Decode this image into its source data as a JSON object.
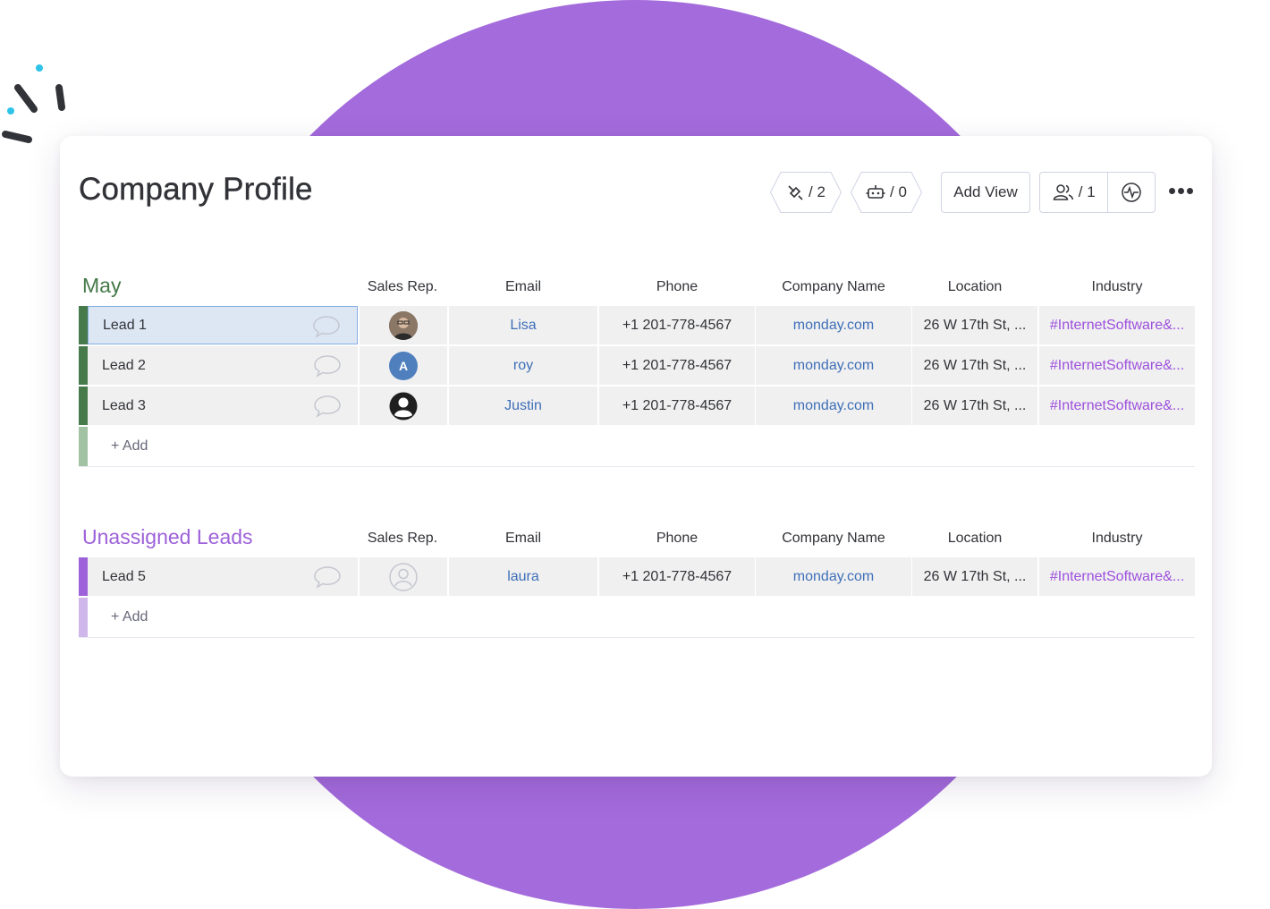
{
  "board": {
    "title": "Company Profile",
    "toolbar": {
      "integrations_count": "/ 2",
      "automations_count": "/ 0",
      "add_view_label": "Add View",
      "members_count": "/ 1"
    }
  },
  "columns": [
    "Sales Rep.",
    "Email",
    "Phone",
    "Company Name",
    "Location",
    "Industry"
  ],
  "groups": [
    {
      "title": "May",
      "color": "#467a4a",
      "add_label": "+ Add",
      "rows": [
        {
          "name": "Lead 1",
          "rep": "photo",
          "email": "Lisa",
          "phone": "+1 201-778-4567",
          "company": "monday.com",
          "location": "26 W 17th St, ...",
          "industry": "#InternetSoftware&..."
        },
        {
          "name": "Lead 2",
          "rep": "A",
          "email": "roy",
          "phone": "+1 201-778-4567",
          "company": "monday.com",
          "location": "26 W 17th St, ...",
          "industry": "#InternetSoftware&..."
        },
        {
          "name": "Lead 3",
          "rep": "person",
          "email": "Justin",
          "phone": "+1 201-778-4567",
          "company": "monday.com",
          "location": "26 W 17th St, ...",
          "industry": "#InternetSoftware&..."
        }
      ]
    },
    {
      "title": "Unassigned Leads",
      "color": "#9d61d9",
      "add_label": "+ Add",
      "rows": [
        {
          "name": "Lead 5",
          "rep": "empty",
          "email": "laura",
          "phone": "+1 201-778-4567",
          "company": "monday.com",
          "location": "26 W 17th St, ...",
          "industry": "#InternetSoftware&..."
        }
      ]
    }
  ],
  "colors": {
    "background_circle": "#a36bdb",
    "may_stripe": "#467a4a",
    "may_add_stripe": "#a1c2a3",
    "unassigned_stripe": "#9d61d9",
    "unassigned_add_stripe": "#cfb7ec",
    "link": "#3f6fb8",
    "tag": "#9d50dd"
  }
}
